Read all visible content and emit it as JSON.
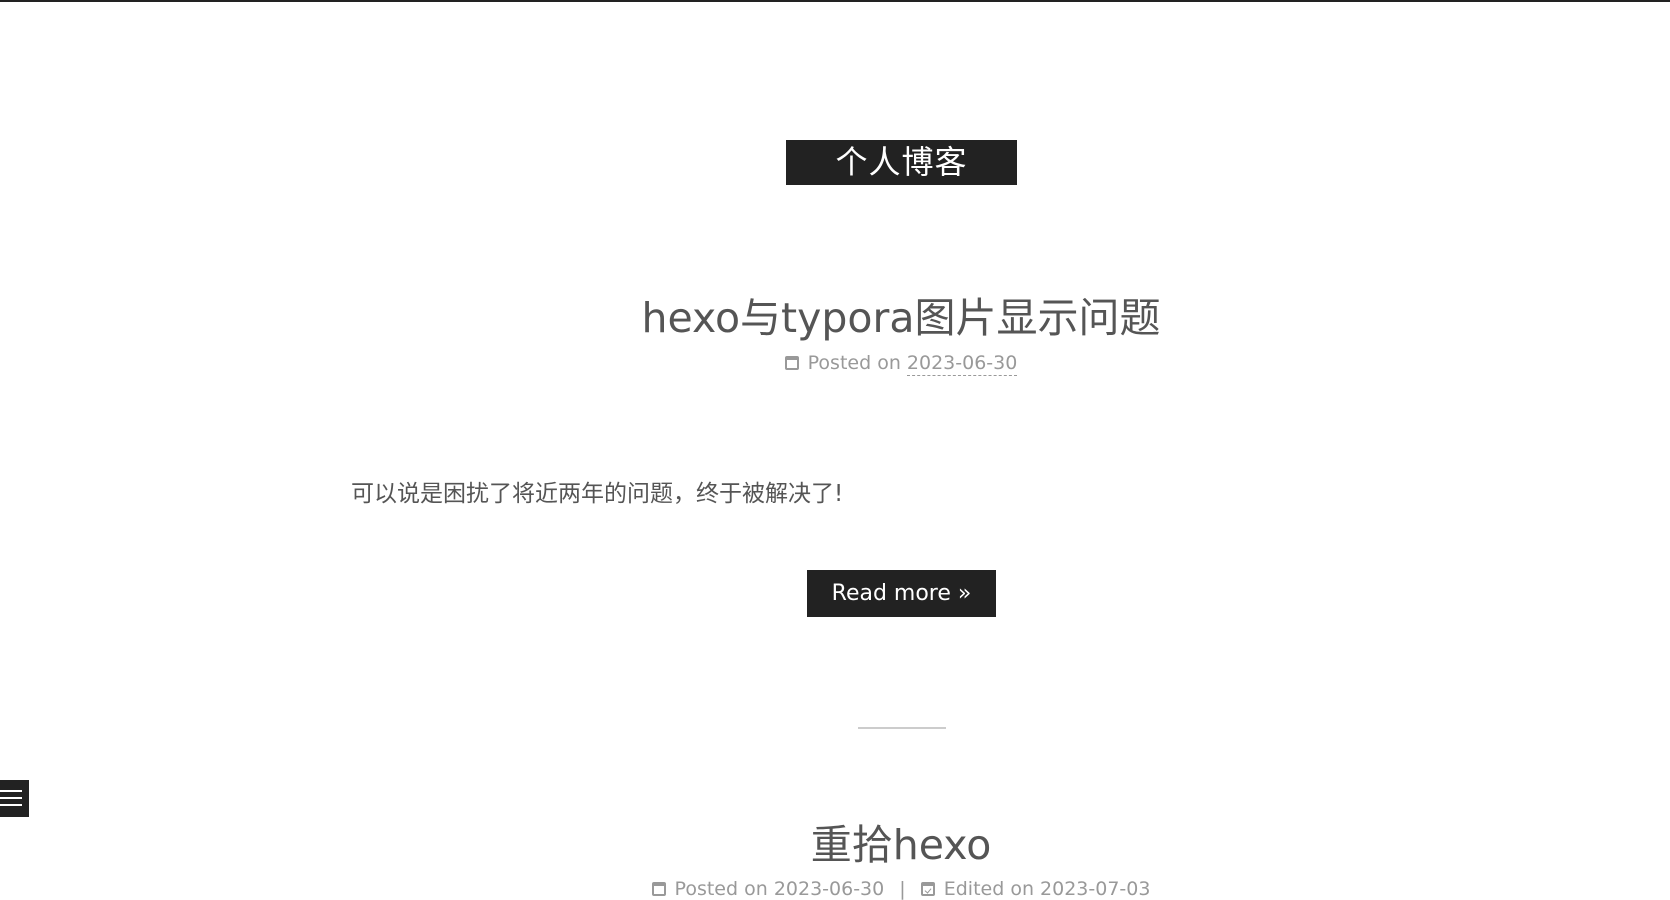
{
  "site": {
    "title": "个人博客"
  },
  "posts": [
    {
      "title": "hexo与typora图片显示问题",
      "posted_label": "Posted on",
      "posted_date": "2023-06-30",
      "excerpt": "可以说是困扰了将近两年的问题，终于被解决了!",
      "read_more": "Read more »"
    },
    {
      "title": "重拾hexo",
      "posted_label": "Posted on",
      "posted_date": "2023-06-30",
      "divider": "|",
      "edited_label": "Edited on",
      "edited_date": "2023-07-03"
    }
  ],
  "icons": {
    "posted": "calendar-icon",
    "edited": "calendar-check-icon",
    "sidebar_toggle": "hamburger-menu-icon"
  },
  "colors": {
    "accent": "#222222",
    "text": "#555555",
    "meta": "#999999",
    "background": "#ffffff"
  }
}
